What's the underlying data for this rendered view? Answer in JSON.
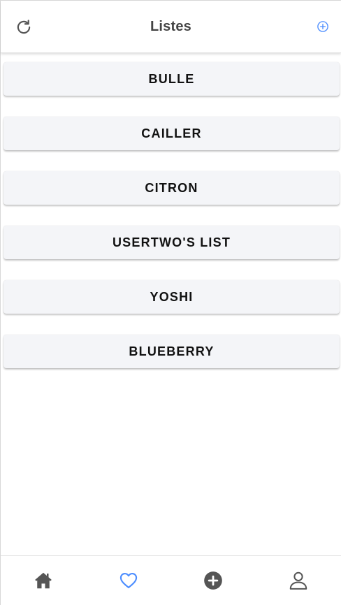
{
  "header": {
    "title": "Listes",
    "refresh_icon": "refresh-icon",
    "add_icon": "add-circle-outline-icon"
  },
  "lists": [
    {
      "label": "BULLE"
    },
    {
      "label": "CAILLER"
    },
    {
      "label": "CITRON"
    },
    {
      "label": "USERTWO'S LIST"
    },
    {
      "label": "YOSHI"
    },
    {
      "label": "BLUEBERRY"
    }
  ],
  "tabbar": {
    "tabs": [
      {
        "icon": "home-icon",
        "active": false
      },
      {
        "icon": "heart-outline-icon",
        "active": true
      },
      {
        "icon": "add-circle-icon",
        "active": false
      },
      {
        "icon": "person-outline-icon",
        "active": false
      }
    ]
  },
  "colors": {
    "accent": "#4c8dff",
    "title": "#444444",
    "list_button_bg": "#f4f5f8",
    "icon_inactive": "#555555"
  }
}
